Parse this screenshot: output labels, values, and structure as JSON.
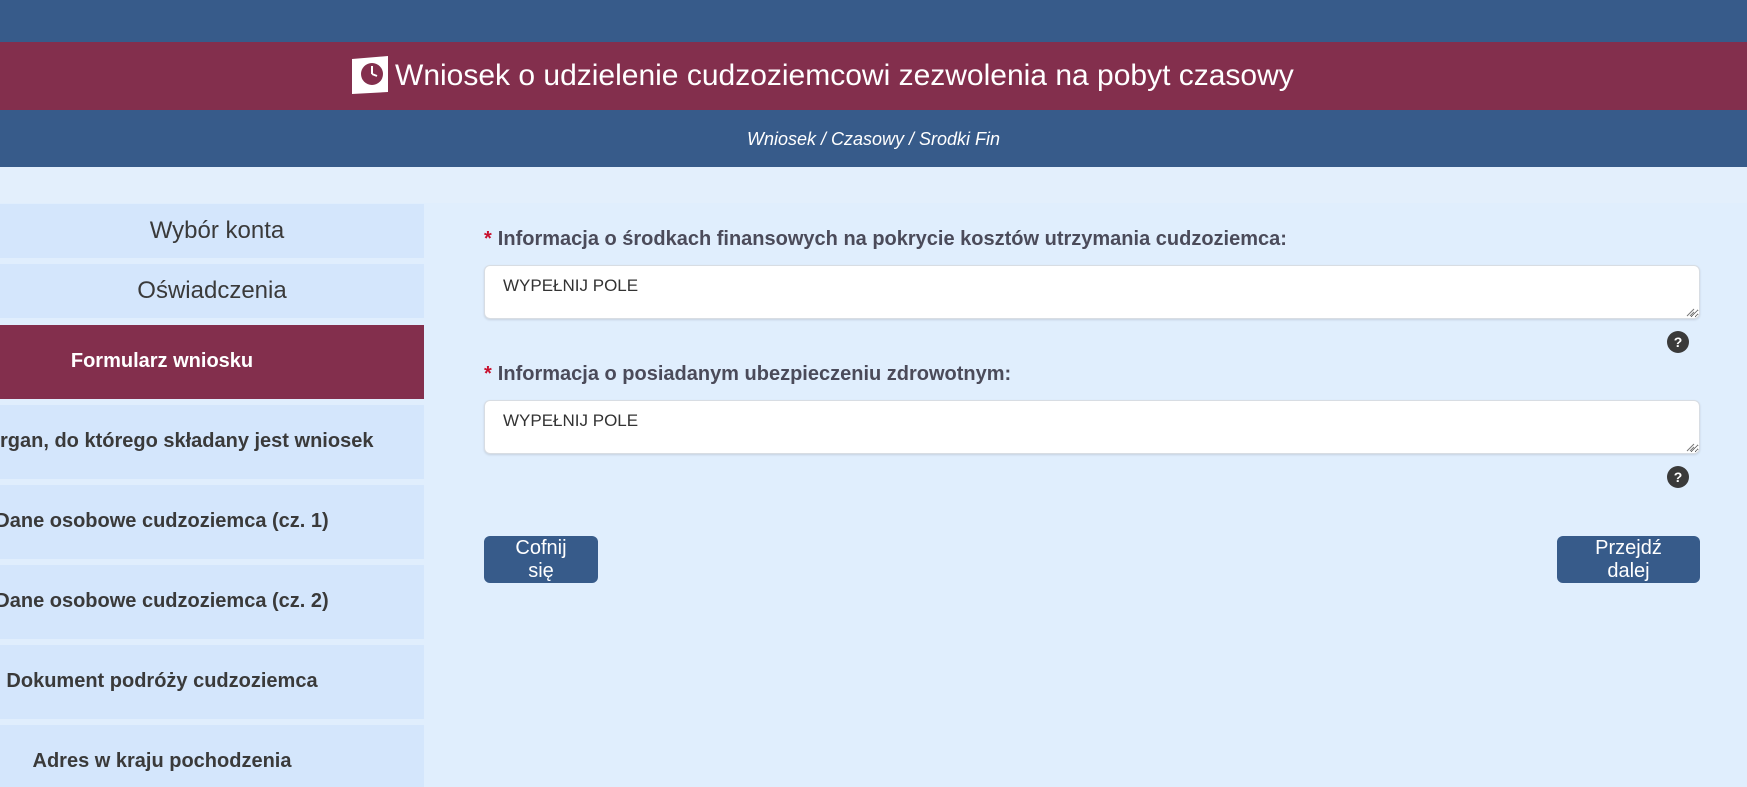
{
  "header": {
    "title": "Wniosek o udzielenie cudzoziemcowi zezwolenia na pobyt czasowy",
    "icon": "clock-document-icon",
    "breadcrumb": "Wniosek / Czasowy / Srodki Fin"
  },
  "sidebar": {
    "items": [
      {
        "label": "Wybór konta",
        "active": false
      },
      {
        "label": "Oświadczenia",
        "active": false
      },
      {
        "label": "Formularz wniosku",
        "active": true
      },
      {
        "label": "rgan, do którego składany jest wniosek",
        "active": false
      },
      {
        "label": "Dane osobowe cudzoziemca (cz. 1)",
        "active": false
      },
      {
        "label": "Dane osobowe cudzoziemca (cz. 2)",
        "active": false
      },
      {
        "label": "Dokument podróży cudzoziemca",
        "active": false
      },
      {
        "label": "Adres w kraju pochodzenia",
        "active": false
      }
    ]
  },
  "form": {
    "required_marker": "*",
    "fields": [
      {
        "label": "Informacja o środkach finansowych na pokrycie kosztów utrzymania cudzoziemca:",
        "value": "WYPEŁNIJ POLE",
        "help": "?"
      },
      {
        "label": "Informacja o posiadanym ubezpieczeniu zdrowotnym:",
        "value": "WYPEŁNIJ POLE",
        "help": "?"
      }
    ],
    "back_label": "Cofnij się",
    "next_label": "Przejdź dalej"
  },
  "colors": {
    "primary_blue": "#375b8a",
    "accent_maroon": "#832f4d",
    "page_bg": "#e0eefd",
    "sidebar_bg": "#d4e6fc",
    "required_red": "#c8102e"
  }
}
